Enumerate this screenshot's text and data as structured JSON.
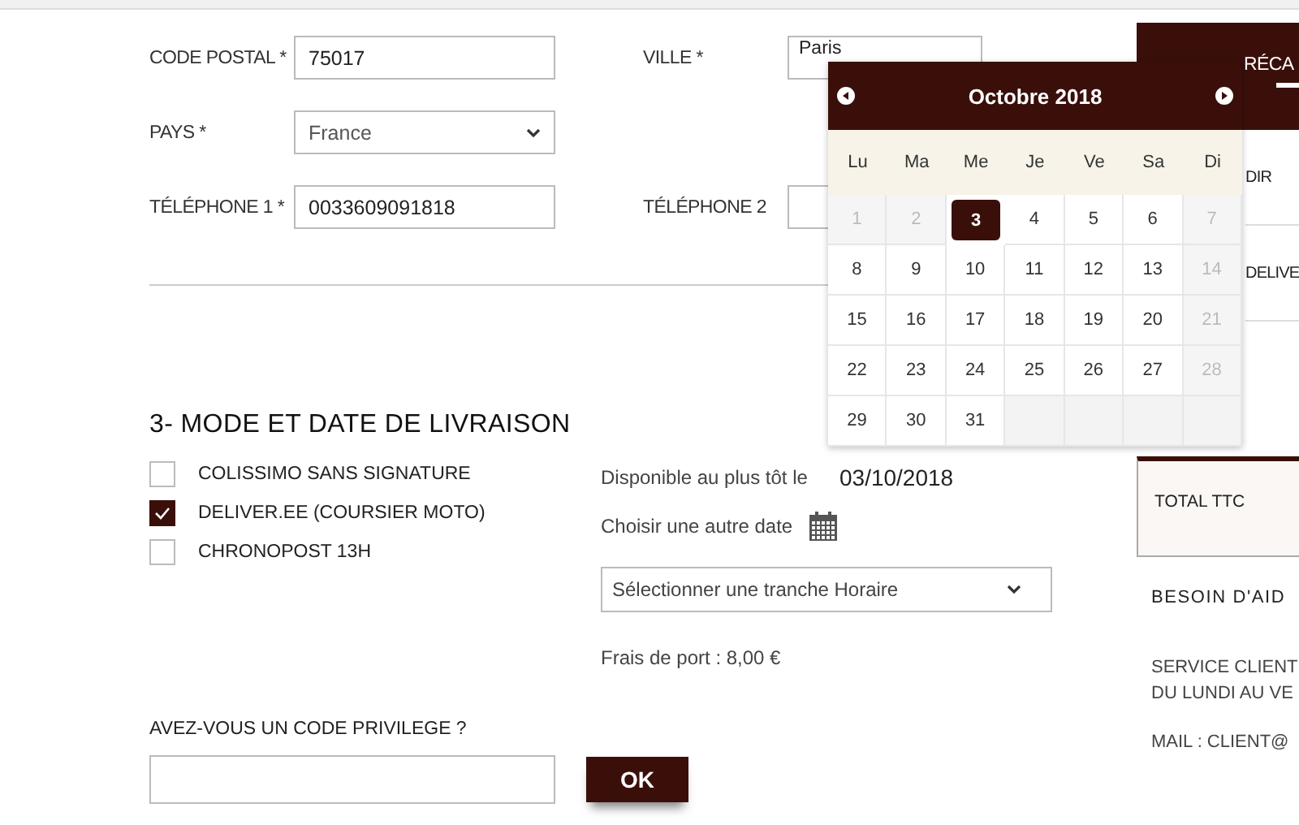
{
  "address": {
    "rows": [
      {
        "left": {
          "label": "CODE POSTAL *",
          "kind": "input",
          "value": "75017"
        },
        "right": {
          "label": "VILLE *",
          "kind": "input",
          "value": "Paris"
        }
      },
      {
        "left": {
          "label": "PAYS *",
          "kind": "select",
          "value": "France"
        }
      },
      {
        "left": {
          "label": "TÉLÉPHONE 1 *",
          "kind": "input",
          "value": "0033609091818"
        },
        "right": {
          "label": "TÉLÉPHONE 2",
          "kind": "input"
        }
      }
    ]
  },
  "delivery": {
    "heading": "3- MODE ET DATE DE LIVRAISON",
    "options": [
      {
        "label": "COLISSIMO SANS SIGNATURE",
        "checked": false
      },
      {
        "label": "DELIVER.EE (COURSIER MOTO)",
        "checked": true
      },
      {
        "label": "CHRONOPOST 13H",
        "checked": false
      }
    ],
    "earliest_label": "Disponible au plus tôt le",
    "earliest_date": "03/10/2018",
    "other_date_label": "Choisir une autre date",
    "time_slot": {
      "value": "Sélectionner une tranche Horaire"
    },
    "shipping": "Frais de port : 8,00 €"
  },
  "promo": {
    "label": "AVEZ-VOUS UN CODE PRIVILEGE ?",
    "button": "OK"
  },
  "calendar": {
    "month": "Octobre 2018",
    "weekdays": [
      "Lu",
      "Ma",
      "Me",
      "Je",
      "Ve",
      "Sa",
      "Di"
    ],
    "weeks": [
      [
        {
          "day": "1",
          "disabled": true,
          "selected": false
        },
        {
          "day": "2",
          "disabled": true,
          "selected": false
        },
        {
          "day": "3",
          "disabled": false,
          "selected": true
        },
        {
          "day": "4",
          "disabled": false,
          "selected": false
        },
        {
          "day": "5",
          "disabled": false,
          "selected": false
        },
        {
          "day": "6",
          "disabled": false,
          "selected": false
        },
        {
          "day": "7",
          "disabled": true,
          "selected": false
        }
      ],
      [
        {
          "day": "8",
          "disabled": false,
          "selected": false
        },
        {
          "day": "9",
          "disabled": false,
          "selected": false
        },
        {
          "day": "10",
          "disabled": false,
          "selected": false
        },
        {
          "day": "11",
          "disabled": false,
          "selected": false
        },
        {
          "day": "12",
          "disabled": false,
          "selected": false
        },
        {
          "day": "13",
          "disabled": false,
          "selected": false
        },
        {
          "day": "14",
          "disabled": true,
          "selected": false
        }
      ],
      [
        {
          "day": "15",
          "disabled": false,
          "selected": false
        },
        {
          "day": "16",
          "disabled": false,
          "selected": false
        },
        {
          "day": "17",
          "disabled": false,
          "selected": false
        },
        {
          "day": "18",
          "disabled": false,
          "selected": false
        },
        {
          "day": "19",
          "disabled": false,
          "selected": false
        },
        {
          "day": "20",
          "disabled": false,
          "selected": false
        },
        {
          "day": "21",
          "disabled": true,
          "selected": false
        }
      ],
      [
        {
          "day": "22",
          "disabled": false,
          "selected": false
        },
        {
          "day": "23",
          "disabled": false,
          "selected": false
        },
        {
          "day": "24",
          "disabled": false,
          "selected": false
        },
        {
          "day": "25",
          "disabled": false,
          "selected": false
        },
        {
          "day": "26",
          "disabled": false,
          "selected": false
        },
        {
          "day": "27",
          "disabled": false,
          "selected": false
        },
        {
          "day": "28",
          "disabled": true,
          "selected": false
        }
      ],
      [
        {
          "day": "29",
          "disabled": false,
          "selected": false
        },
        {
          "day": "30",
          "disabled": false,
          "selected": false
        },
        {
          "day": "31",
          "disabled": false,
          "selected": false
        }
      ]
    ]
  },
  "sidebar": {
    "tab": "RÉCA",
    "lines": [
      "DIR",
      "DELIVE"
    ],
    "total": "TOTAL TTC",
    "help_title": "BESOIN D'AID",
    "help_lines": [
      "SERVICE CLIENT",
      "DU LUNDI AU VE"
    ],
    "mail": "MAIL : CLIENT@"
  }
}
